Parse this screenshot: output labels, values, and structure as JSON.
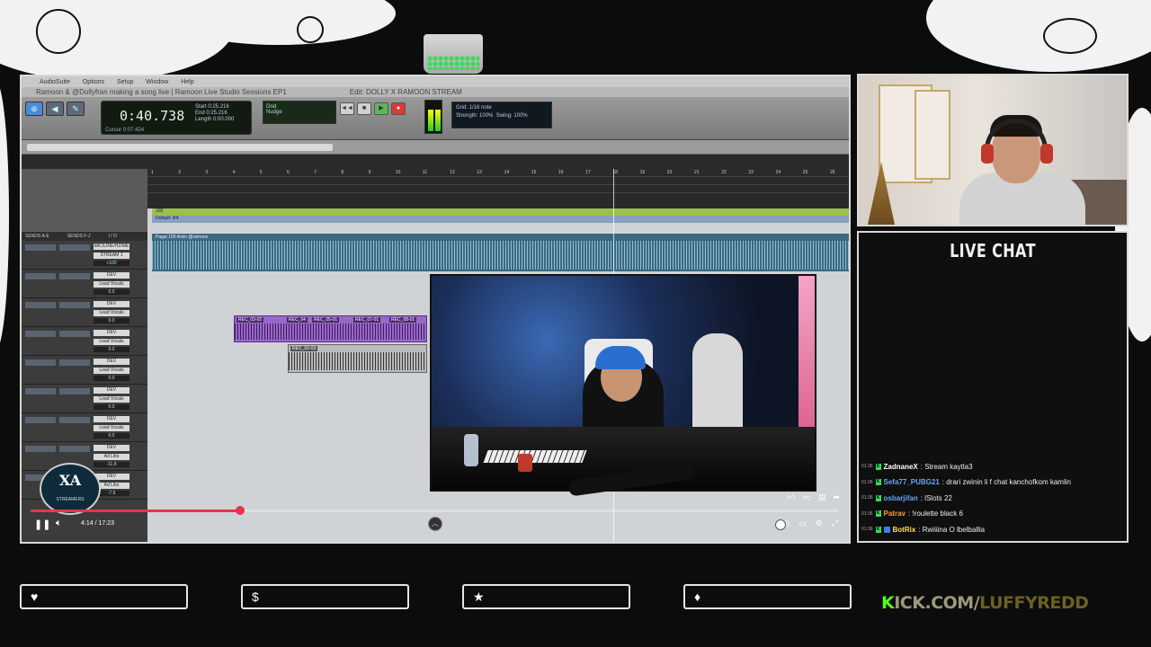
{
  "daw": {
    "menu": [
      "AudioSuite",
      "Options",
      "Setup",
      "Window",
      "Help"
    ],
    "video_title": "Ramoon & @Dollyfran making a song live | Ramoon Live Studio Sessions EP1",
    "edit_window": "Edit: DOLLY X RAMOON STREAM",
    "counter_main": "0:40.738",
    "counter_start": "0:25.216",
    "counter_end": "0:25.216",
    "counter_length": "0:00.000",
    "cursor": "Cursor   0:07.424",
    "nudge_label": "Nudge",
    "grid_label": "Grid",
    "grid_value": "1/16 note",
    "strength": "Strength: 100%",
    "swing": "Swing: 100%",
    "sends_header": [
      "SENDS A-E",
      "SENDS F-J",
      "I / O"
    ],
    "tempo_label": "100",
    "meter_label": "Default: 4/4",
    "ruler_bars": [
      "1",
      "2",
      "3",
      "4",
      "5",
      "6",
      "7",
      "8",
      "9",
      "10",
      "11",
      "12",
      "13",
      "14",
      "15",
      "16",
      "17",
      "18",
      "19",
      "20",
      "21",
      "22",
      "23",
      "24",
      "25",
      "26"
    ],
    "track_clip_label": "Pagai 100 Amin @ramoon",
    "clip_labels": [
      "REC_03-02",
      "REC_04",
      "REC_05-01",
      "REC_07-01",
      "REC_08-01"
    ],
    "gray_clip_label": "REC_03-03",
    "mixer_rows": [
      {
        "io": "MIC/LINE/HZ/ME",
        "io2": "STREAM 1",
        "vol": "+100"
      },
      {
        "io": "DEV",
        "io2": "Lead Vocals",
        "vol": "0.0"
      },
      {
        "io": "DEV",
        "io2": "Lead Vocals",
        "vol": "0.0"
      },
      {
        "io": "DEV",
        "io2": "Lead Vocals",
        "vol": "0.0"
      },
      {
        "io": "DEV",
        "io2": "Lead Vocals",
        "vol": "0.0"
      },
      {
        "io": "DEV",
        "io2": "Lead Vocals",
        "vol": "0.0"
      },
      {
        "io": "DEV",
        "io2": "Lead Vocals",
        "vol": "0.0"
      },
      {
        "io": "DEV",
        "io2": "Ad Libs",
        "vol": "-11.8"
      },
      {
        "io": "DEV",
        "io2": "Ad Libs",
        "vol": "-7.9"
      }
    ]
  },
  "player": {
    "time": "4:14 / 17:23",
    "progress": 0.26,
    "play_state_icon": "pause-icon"
  },
  "logo": {
    "mark": "XA",
    "subtitle": "STREAMERS"
  },
  "chat": {
    "title": "LIVE CHAT",
    "messages": [
      {
        "time": "01:36",
        "user": "ZadnaneX",
        "color": "#ffffff",
        "text": ": Stream kaytla3",
        "bot": false
      },
      {
        "time": "01:36",
        "user": "Sefa77_PUBG21",
        "color": "#6aa5ff",
        "text": ": drari zwinin li f chat kanchofkom kamlin",
        "bot": false
      },
      {
        "time": "01:36",
        "user": "osbarjifan",
        "color": "#6aa5ff",
        "text": ": lSlots 22",
        "bot": false
      },
      {
        "time": "01:36",
        "user": "Patrav",
        "color": "#ff9b3d",
        "text": ": !roulette black 6",
        "bot": false
      },
      {
        "time": "01:36",
        "user": "BotRix",
        "color": "#ffe14a",
        "text": ": Rwiiiina O lbelballia",
        "bot": true
      }
    ]
  },
  "actions": [
    {
      "icon": "heart-icon",
      "glyph": "♥"
    },
    {
      "icon": "dollar-icon",
      "glyph": "$"
    },
    {
      "icon": "star-icon",
      "glyph": "★"
    },
    {
      "icon": "drop-icon",
      "glyph": "♦"
    }
  ],
  "kick": {
    "k": "K",
    "rest": "ICK.COM/",
    "user": "LUFFYREDD"
  },
  "colors": {
    "accent_red": "#e8334a",
    "kick_green": "#53fc18",
    "clip_purple": "#9a67c9"
  }
}
